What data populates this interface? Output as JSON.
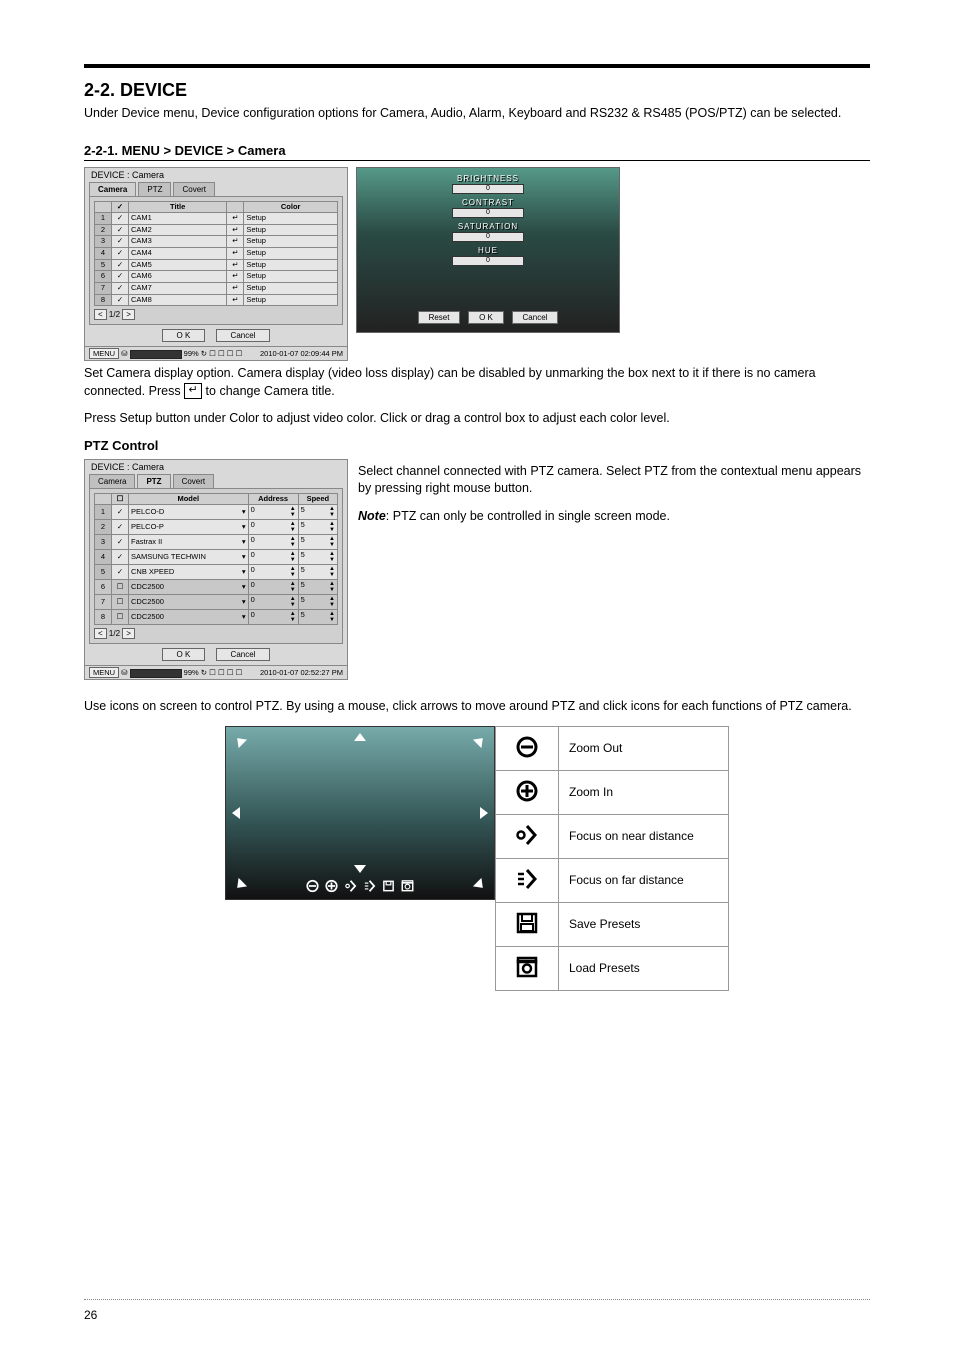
{
  "section": {
    "title": "2-2. DEVICE"
  },
  "intro": "Under Device menu, Device configuration options for Camera, Audio, Alarm, Keyboard and RS232 & RS485 (POS/PTZ) can be selected.",
  "sub1": {
    "title": "2-2-1. MENU > DEVICE > Camera"
  },
  "camera_panel": {
    "path": "DEVICE : Camera",
    "tabs": [
      "Camera",
      "PTZ",
      "Covert"
    ],
    "active_tab": 0,
    "headers": {
      "title": "Title",
      "color": "Color"
    },
    "rows": [
      {
        "n": "1",
        "chk": true,
        "title": "CAM1",
        "color": "Setup"
      },
      {
        "n": "2",
        "chk": true,
        "title": "CAM2",
        "color": "Setup"
      },
      {
        "n": "3",
        "chk": true,
        "title": "CAM3",
        "color": "Setup"
      },
      {
        "n": "4",
        "chk": true,
        "title": "CAM4",
        "color": "Setup"
      },
      {
        "n": "5",
        "chk": true,
        "title": "CAM5",
        "color": "Setup"
      },
      {
        "n": "6",
        "chk": true,
        "title": "CAM6",
        "color": "Setup"
      },
      {
        "n": "7",
        "chk": true,
        "title": "CAM7",
        "color": "Setup"
      },
      {
        "n": "8",
        "chk": true,
        "title": "CAM8",
        "color": "Setup"
      }
    ],
    "pager": "1/2",
    "ok": "O K",
    "cancel": "Cancel",
    "menu_label": "MENU",
    "hdd_pct": "99%",
    "timestamp": "2010-01-07 02:09:44 PM"
  },
  "brightness_panel": {
    "labels": [
      "BRIGHTNESS",
      "CONTRAST",
      "SATURATION",
      "HUE"
    ],
    "slider_val": "0",
    "reset": "Reset",
    "ok": "O K",
    "cancel": "Cancel"
  },
  "text_after_1a": "Set Camera display option. Camera display (video loss display) can be disabled by unmarking the box next to it if there is no camera connected. Press ",
  "text_after_1b": " to change Camera title.",
  "enter_icon_char": "↵",
  "text_after_2": "Press Setup button under Color to adjust video color. Click or drag a control box to adjust each color level.",
  "ptz_heading": "PTZ Control",
  "ptz_panel": {
    "path": "DEVICE : Camera",
    "tabs": [
      "Camera",
      "PTZ",
      "Covert"
    ],
    "active_tab": 1,
    "headers": {
      "model": "Model",
      "address": "Address",
      "speed": "Speed"
    },
    "rows": [
      {
        "n": "1",
        "chk": true,
        "model": "PELCO-D",
        "address": "0",
        "speed": "5",
        "enabled": true
      },
      {
        "n": "2",
        "chk": true,
        "model": "PELCO-P",
        "address": "0",
        "speed": "5",
        "enabled": true
      },
      {
        "n": "3",
        "chk": true,
        "model": "Fastrax II",
        "address": "0",
        "speed": "5",
        "enabled": true
      },
      {
        "n": "4",
        "chk": true,
        "model": "SAMSUNG TECHWIN",
        "address": "0",
        "speed": "5",
        "enabled": true
      },
      {
        "n": "5",
        "chk": true,
        "model": "CNB XPEED",
        "address": "0",
        "speed": "5",
        "enabled": true
      },
      {
        "n": "6",
        "chk": false,
        "model": "CDC2500",
        "address": "0",
        "speed": "5",
        "enabled": false
      },
      {
        "n": "7",
        "chk": false,
        "model": "CDC2500",
        "address": "0",
        "speed": "5",
        "enabled": false
      },
      {
        "n": "8",
        "chk": false,
        "model": "CDC2500",
        "address": "0",
        "speed": "5",
        "enabled": false
      }
    ],
    "pager": "1/2",
    "ok": "O K",
    "cancel": "Cancel",
    "menu_label": "MENU",
    "hdd_pct": "99%",
    "timestamp": "2010-01-07 02:52:27 PM"
  },
  "ptz_side_1": "Select channel connected with PTZ camera. Select PTZ from the contextual menu appears by pressing right mouse button.",
  "ptz_note_label": "Note",
  "ptz_note_text": ": PTZ can only be controlled in single screen mode.",
  "text_after_3": "Use icons on screen to control PTZ. By using a mouse, click arrows to move around PTZ and click icons for each functions of PTZ camera.",
  "icon_table": [
    {
      "icon": "zoom-out",
      "label": "Zoom Out"
    },
    {
      "icon": "zoom-in",
      "label": "Zoom In"
    },
    {
      "icon": "focus-near",
      "label": "Focus on near distance"
    },
    {
      "icon": "focus-far",
      "label": "Focus on far distance"
    },
    {
      "icon": "save-preset",
      "label": "Save Presets"
    },
    {
      "icon": "load-preset",
      "label": "Load Presets"
    }
  ],
  "page_number": "26"
}
